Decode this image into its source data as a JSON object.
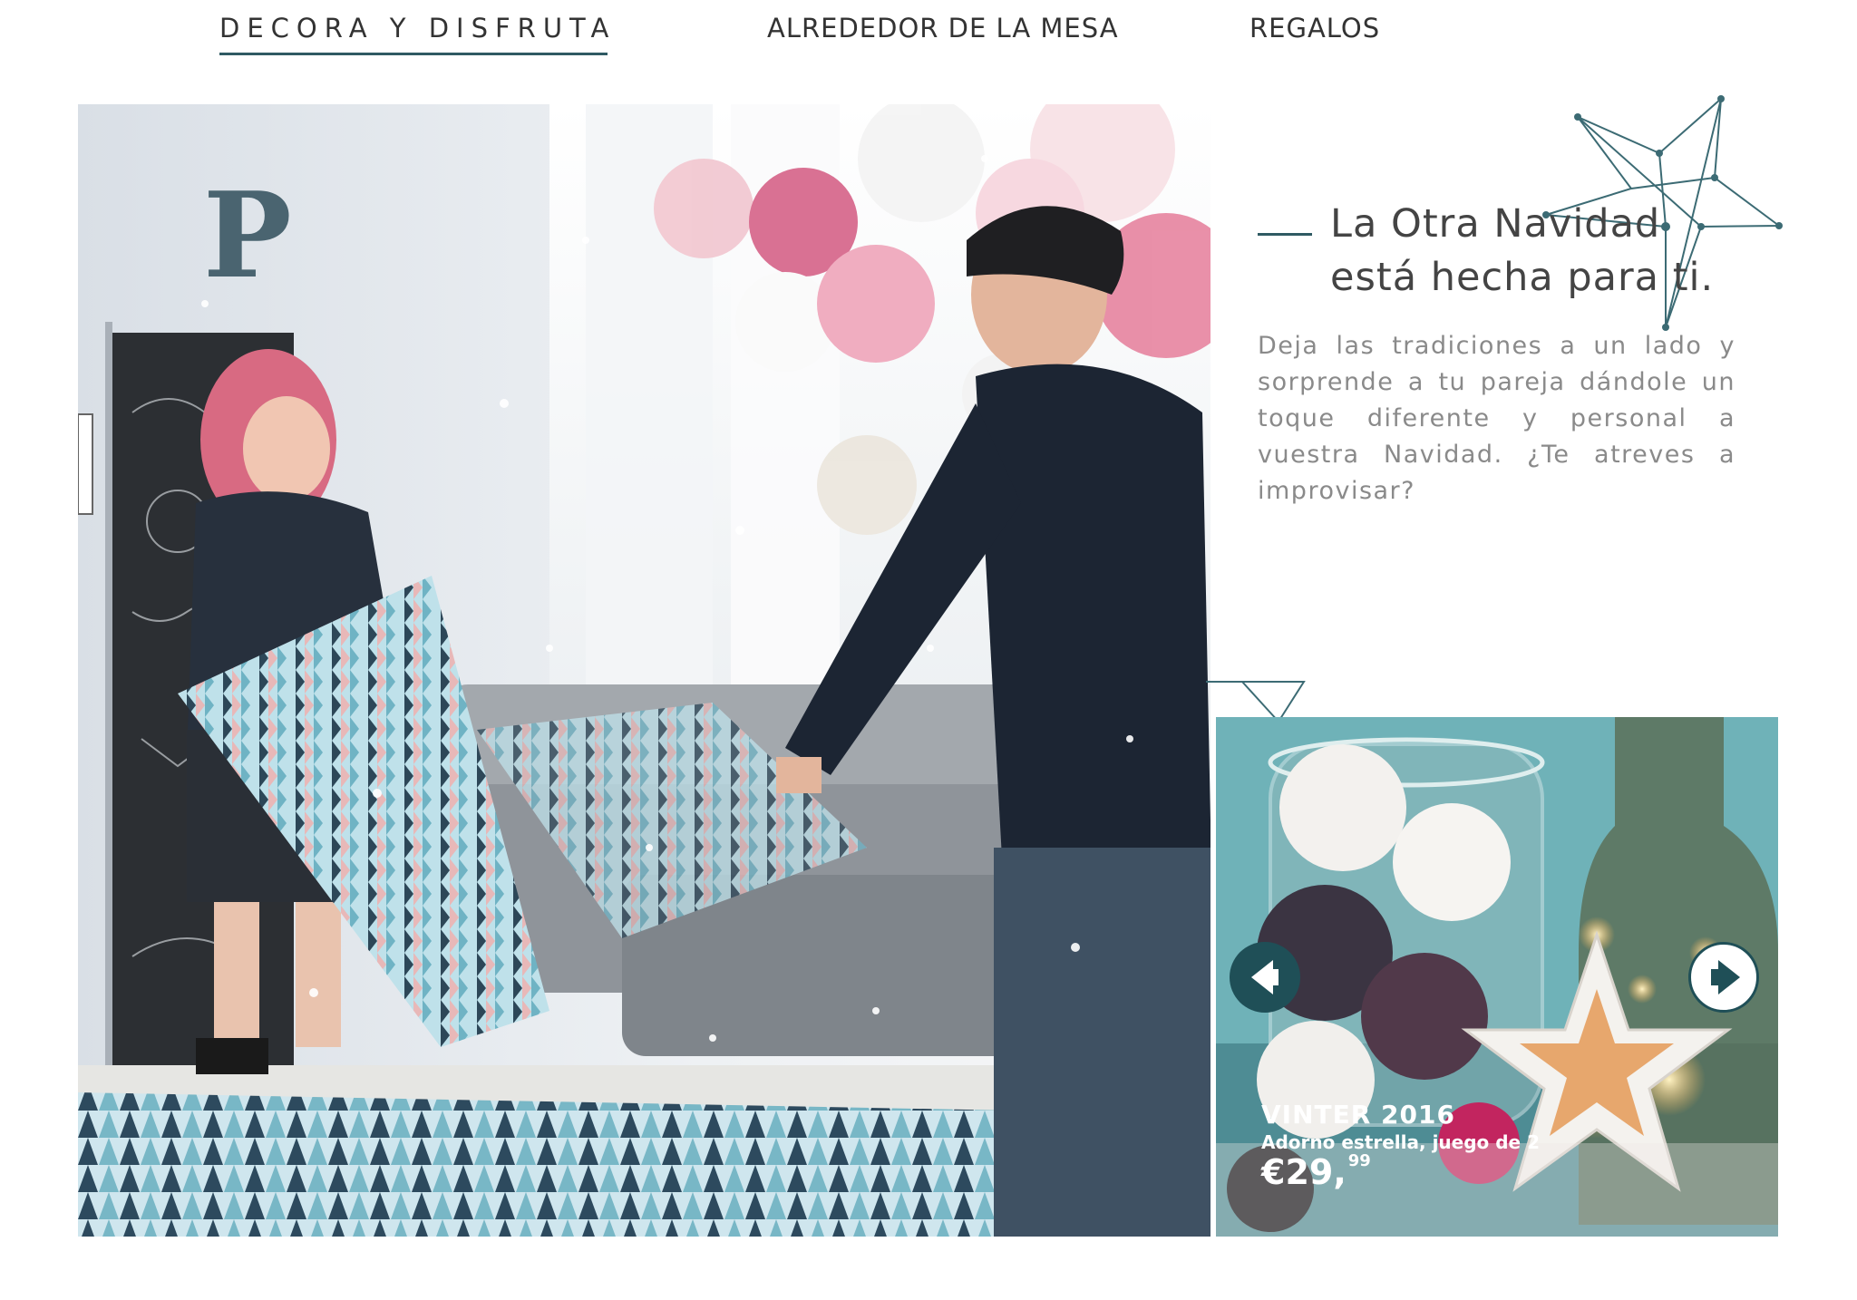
{
  "nav": {
    "items": [
      {
        "label": "DECORA Y DISFRUTA",
        "active": true
      },
      {
        "label": "ALREDEDOR DE LA MESA",
        "active": false
      },
      {
        "label": "REGALOS",
        "active": false
      }
    ]
  },
  "hero": {
    "image_alt": "Pareja en una pelea de almohadas en un dormitorio decorado para Navidad",
    "wall_letter": "P"
  },
  "intro": {
    "headline_line1": "La Otra Navidad",
    "headline_line2": "está hecha para ti.",
    "body": "Deja las tradiciones a un lado y sorprende a tu pareja dándole un toque diferente y personal a vuestra Navidad. ¿Te atreves a improvisar?"
  },
  "product_card": {
    "name": "VINTER 2016",
    "description": "Adorno estrella, juego de 2",
    "price_main": "€29,",
    "price_cents": "99",
    "prev_icon": "arrow-left-icon",
    "next_icon": "arrow-right-icon"
  },
  "colors": {
    "accent": "#1f4f57",
    "text_dark": "#333333",
    "text_muted": "#8a8a8a"
  }
}
